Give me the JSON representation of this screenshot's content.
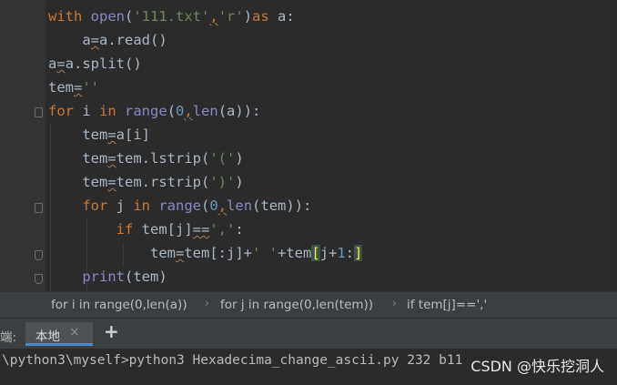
{
  "code": {
    "l1_with": "with",
    "l1_open": "open",
    "l1_p1": "(",
    "l1_s1": "'111.txt'",
    "l1_c": ",",
    "l1_s2": "'r'",
    "l1_p2": ")",
    "l1_as": "as",
    "l1_rest": " a:",
    "l2_a": "a",
    "l2_eq": "=",
    "l2_rest": "a.read()",
    "l3_a": "a",
    "l3_eq": "=",
    "l3_rest": "a.split()",
    "l4_tem": "tem",
    "l4_eq": "=",
    "l4_str": "''",
    "l5_for": "for",
    "l5_i": " i ",
    "l5_in": "in",
    "l5_range": "range",
    "l5_p1": "(",
    "l5_zero": "0",
    "l5_c": ",",
    "l5_len": "len",
    "l5_rest": "(a)):",
    "l6_tem": "tem",
    "l6_eq": "=",
    "l6_rest": "a[i]",
    "l7_tem": "tem",
    "l7_eq": "=",
    "l7_call": "tem.lstrip(",
    "l7_str": "'('",
    "l7_end": ")",
    "l8_tem": "tem",
    "l8_eq": "=",
    "l8_call": "tem.rstrip(",
    "l8_str": "')'",
    "l8_end": ")",
    "l9_for": "for",
    "l9_j": " j ",
    "l9_in": "in",
    "l9_range": "range",
    "l9_p1": "(",
    "l9_zero": "0",
    "l9_c": ",",
    "l9_len": "len",
    "l9_rest": "(tem)):",
    "l10_if": "if",
    "l10_mid": " tem[j]",
    "l10_eq": "==",
    "l10_str": "','",
    "l10_end": ":",
    "l11_tem": "tem",
    "l11_eq": "=",
    "l11_mid": "tem[:j]+",
    "l11_str": "' '",
    "l11_plus": "+tem",
    "l11_b1": "[",
    "l11_j": "j+",
    "l11_one": "1",
    "l11_colon": ":",
    "l11_b2": "]",
    "l12_print": "print",
    "l12_rest": "(tem)"
  },
  "breadcrumb": {
    "items": [
      "for i in range(0,len(a))",
      "for j in range(0,len(tem))",
      "if tem[j]==','"
    ],
    "separator": "›"
  },
  "terminal": {
    "label": "端:",
    "tab_label": "本地",
    "close_glyph": "×",
    "add_glyph": "+",
    "command_line": "\\python3\\myself>python3 Hexadecima_change_ascii.py 232 b11",
    "watermark": "CSDN @快乐挖洞人"
  },
  "colors": {
    "background": "#2b2b2b",
    "keyword": "#cc7832",
    "string": "#6a8759",
    "number": "#6897bb",
    "builtin": "#8888c6",
    "text": "#a9b7c6",
    "accent": "#4a88c7"
  },
  "icons": {
    "fold": "fold-marker-icon",
    "close": "close-icon",
    "add": "add-icon"
  }
}
